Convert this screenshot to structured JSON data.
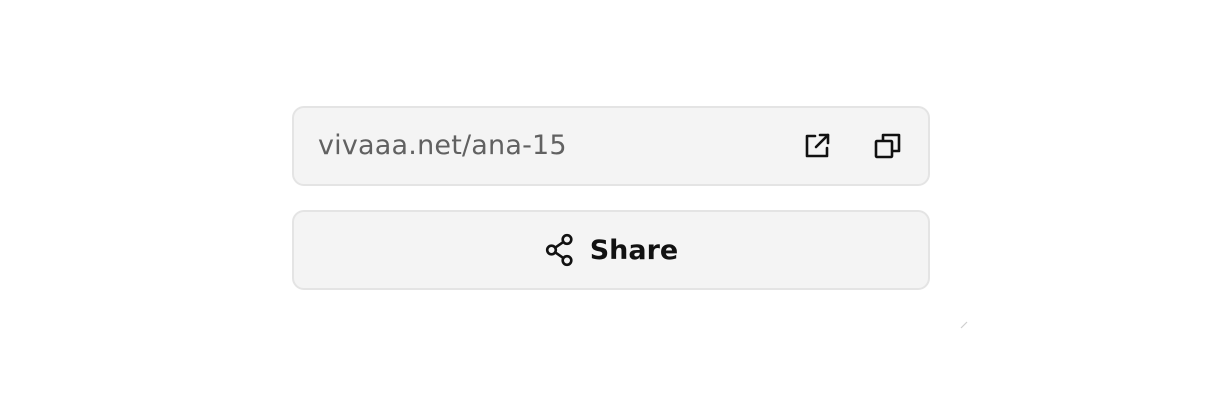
{
  "link": {
    "url_text": "vivaaa.net/ana-15",
    "open_icon": "external-link-icon",
    "copy_icon": "copy-icon"
  },
  "share": {
    "label": "Share",
    "icon": "share-icon"
  },
  "colors": {
    "box_background": "#f4f4f4",
    "box_border": "#e4e4e4",
    "url_text": "#616161",
    "icon_and_label": "#111111"
  }
}
